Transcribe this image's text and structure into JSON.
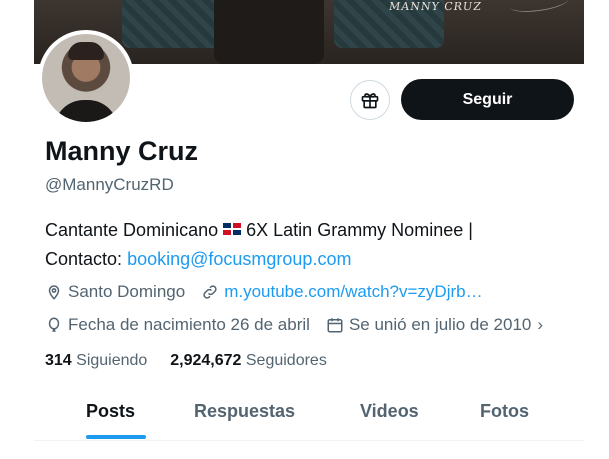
{
  "banner": {
    "brand_text": "MANNY CRUZ"
  },
  "profile": {
    "name": "Manny Cruz",
    "handle": "@MannyCruzRD",
    "bio_part1": "Cantante Dominicano",
    "bio_part2": "6X Latin Grammy Nominee |",
    "bio_contact_label": "Contacto:",
    "bio_email": "booking@focusmgroup.com",
    "location": "Santo Domingo",
    "website": "m.youtube.com/watch?v=zyDjrb…",
    "birthday": "Fecha de nacimiento 26 de abril",
    "joined": "Se unió en julio de 2010"
  },
  "actions": {
    "follow_label": "Seguir",
    "gift_icon": "gift-icon"
  },
  "stats": {
    "following_count": "314",
    "following_label": "Siguiendo",
    "followers_count": "2,924,672",
    "followers_label": "Seguidores"
  },
  "tabs": [
    {
      "label": "Posts",
      "active": true
    },
    {
      "label": "Respuestas",
      "active": false
    },
    {
      "label": "Videos",
      "active": false
    },
    {
      "label": "Fotos",
      "active": false
    }
  ],
  "colors": {
    "link": "#1d9bf0",
    "text": "#0f1419",
    "secondary": "#536471",
    "button": "#0f1419"
  }
}
